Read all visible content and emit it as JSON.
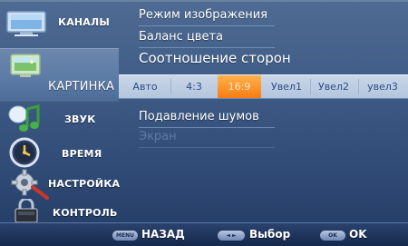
{
  "sidebar": {
    "items": [
      {
        "label": "КАНАЛЫ",
        "icon": "tv-icon"
      },
      {
        "label": "КАРТИНКА",
        "icon": "picture-icon",
        "active": true
      },
      {
        "label": "ЗВУК",
        "icon": "music-note-icon"
      },
      {
        "label": "ВРЕМЯ",
        "icon": "clock-icon"
      },
      {
        "label": "НАСТРОЙКА",
        "icon": "gear-icon"
      },
      {
        "label": "КОНТРОЛЬ",
        "icon": "lock-icon"
      }
    ]
  },
  "main": {
    "items": [
      {
        "label": "Режим изображения"
      },
      {
        "label": "Баланс цвета"
      },
      {
        "label": "Соотношение сторон",
        "focused": true
      },
      {
        "label": "Подавление шумов"
      },
      {
        "label": "Экран",
        "disabled": true
      }
    ],
    "aspect_options": [
      "Авто",
      "4:3",
      "16:9",
      "Увел1",
      "Увел2",
      "увел3"
    ],
    "aspect_selected": "16:9"
  },
  "bottom_bar": {
    "back_button": "MENU",
    "back_label": "НАЗАД",
    "select_button": "◄ ►",
    "select_label": "Выбор",
    "ok_button": "OK",
    "ok_label": "OK"
  },
  "colors": {
    "background": "#3f5c86",
    "selected_option": "#f57d12",
    "option_text": "#2b4d88",
    "disabled_text": "#5e7aa3"
  }
}
